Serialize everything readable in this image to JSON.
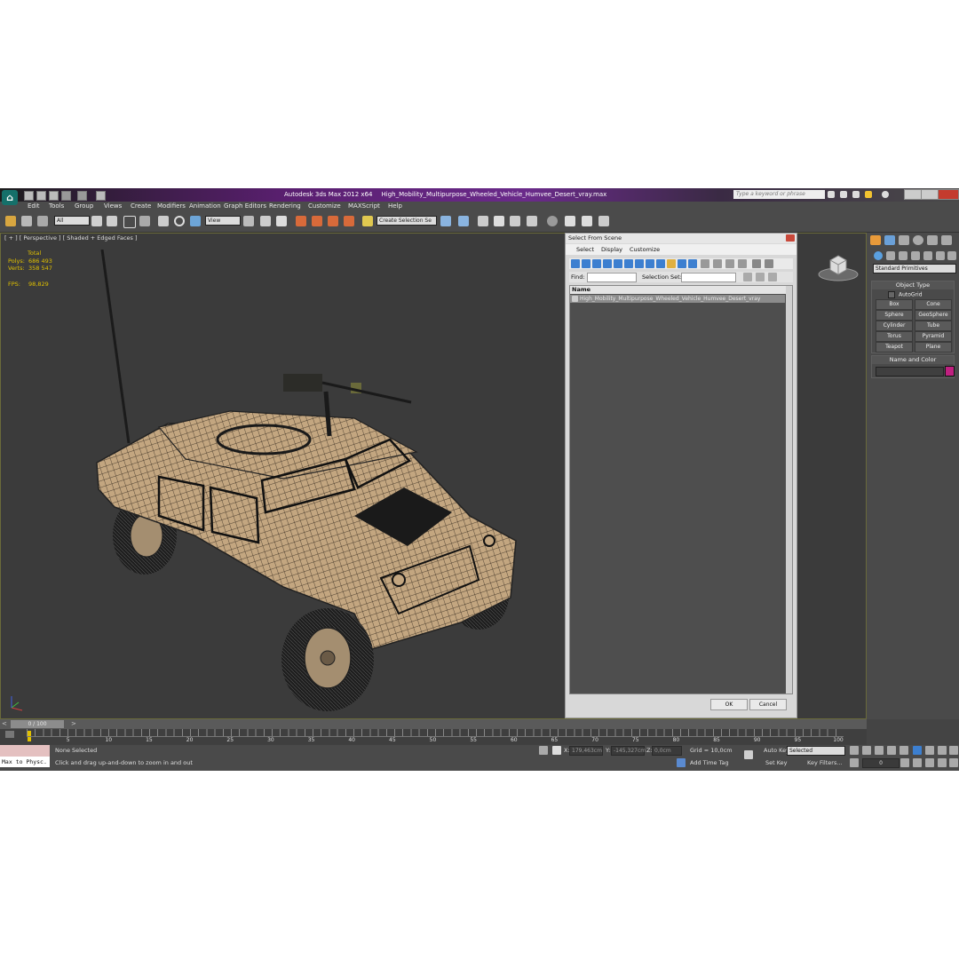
{
  "app": {
    "title": "Autodesk 3ds Max  2012 x64",
    "filename": "High_Mobility_Multipurpose_Wheeled_Vehicle_Humvee_Desert_vray.max",
    "search_placeholder": "Type a keyword or phrase"
  },
  "menu": [
    "Edit",
    "Tools",
    "Group",
    "Views",
    "Create",
    "Modifiers",
    "Animation",
    "Graph Editors",
    "Rendering",
    "Customize",
    "MAXScript",
    "Help"
  ],
  "toolbar": {
    "selection_filter": "All",
    "reference_coord": "View",
    "named_selection": "Create Selection Se"
  },
  "viewport": {
    "label": "[ + ] [ Perspective ] [ Shaded + Edged Faces ]",
    "stats": {
      "total_label": "Total",
      "polys_label": "Polys:",
      "polys_value": "686 493",
      "verts_label": "Verts:",
      "verts_value": "358 547",
      "fps_label": "FPS:",
      "fps_value": "98,829"
    }
  },
  "dialog": {
    "title": "Select From Scene",
    "menu": [
      "Select",
      "Display",
      "Customize"
    ],
    "find_label": "Find:",
    "selection_set_label": "Selection Set:",
    "column_header": "Name",
    "items": [
      "High_Mobility_Multipurpose_Wheeled_Vehicle_Humvee_Desert_vray"
    ],
    "ok_label": "OK",
    "cancel_label": "Cancel"
  },
  "command_panel": {
    "category": "Standard Primitives",
    "object_type_title": "Object Type",
    "autogrid_label": "AutoGrid",
    "buttons": [
      "Box",
      "Cone",
      "Sphere",
      "GeoSphere",
      "Cylinder",
      "Tube",
      "Torus",
      "Pyramid",
      "Teapot",
      "Plane"
    ],
    "name_color_title": "Name and Color",
    "object_color": "#c02080"
  },
  "timeline": {
    "slider_label": "0 / 100",
    "ticks": [
      "5",
      "10",
      "15",
      "20",
      "25",
      "30",
      "35",
      "40",
      "45",
      "50",
      "55",
      "60",
      "65",
      "70",
      "75",
      "80",
      "85",
      "90",
      "95",
      "100"
    ]
  },
  "status": {
    "listener": "Max to Physc.",
    "selection": "None Selected",
    "prompt": "Click and drag up-and-down to zoom in and out",
    "x_label": "X:",
    "x_value": "179,463cm",
    "y_label": "Y:",
    "y_value": "-145,327cm",
    "z_label": "Z:",
    "z_value": "0,0cm",
    "grid": "Grid = 10,0cm",
    "add_time_tag": "Add Time Tag",
    "auto_key": "Auto Key",
    "set_key": "Set Key",
    "key_mode": "Selected",
    "key_filters": "Key Filters...",
    "frame": "0"
  }
}
